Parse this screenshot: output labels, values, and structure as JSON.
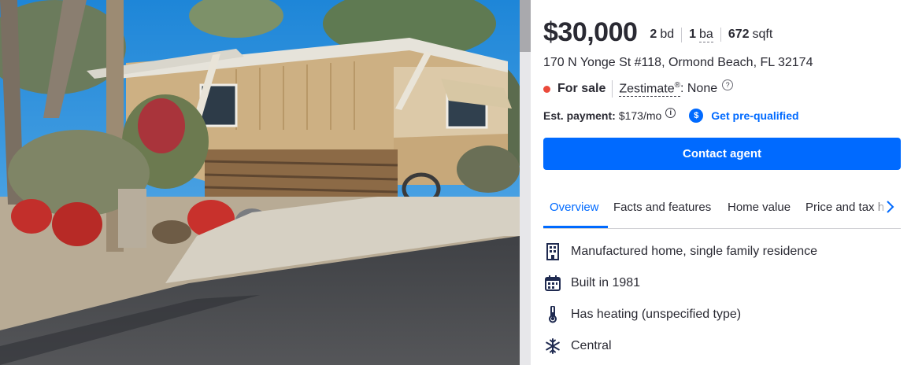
{
  "listing": {
    "price": "$30,000",
    "beds_num": "2",
    "beds_label": "bd",
    "baths_num": "1",
    "baths_label": "ba",
    "sqft_num": "672",
    "sqft_label": "sqft",
    "address": "170 N Yonge St #118, Ormond Beach, FL 32174",
    "status": "For sale",
    "zestimate_label": "Zestimate",
    "zestimate_mark": "®",
    "zestimate_value": ": None",
    "est_payment_label": "Est. payment:",
    "est_payment_value": "$173/mo",
    "prequal_link": "Get pre-qualified"
  },
  "contact_button": "Contact agent",
  "tabs": [
    "Overview",
    "Facts and features",
    "Home value",
    "Price and tax h"
  ],
  "features": [
    {
      "icon": "building-icon",
      "text": "Manufactured home, single family residence"
    },
    {
      "icon": "calendar-icon",
      "text": "Built in 1981"
    },
    {
      "icon": "thermometer-icon",
      "text": "Has heating (unspecified type)"
    },
    {
      "icon": "snowflake-icon",
      "text": "Central"
    }
  ],
  "colors": {
    "accent": "#006aff",
    "status_dot": "#eb4a3b",
    "text": "#2a2a33"
  }
}
